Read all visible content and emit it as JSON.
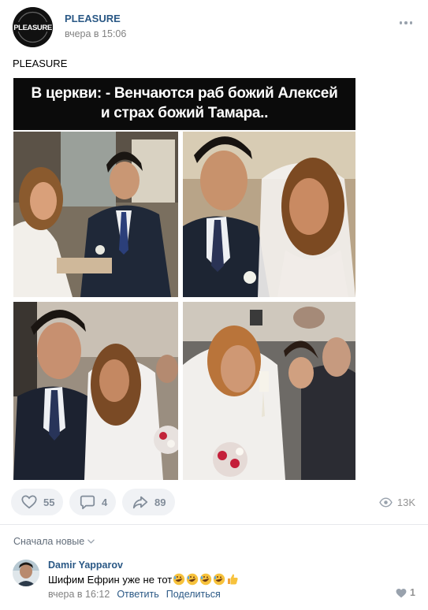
{
  "post": {
    "author": "PLEASURE",
    "avatar_text": "PLEASURE",
    "time": "вчера в 15:06",
    "text": "PLEASURE",
    "media": {
      "caption_line1": "В церкви: - Венчаются раб божий Алексей",
      "caption_line2": "и страх божий Тамара.."
    },
    "actions": {
      "likes": "55",
      "comments": "4",
      "shares": "89",
      "views": "13K"
    }
  },
  "comments_section": {
    "sort_label": "Сначала новые",
    "comments": [
      {
        "author": "Damir Yapparov",
        "text": "Шифим Ефрин уже не тот",
        "emoji": [
          "rolling-laughing",
          "rolling-laughing",
          "rolling-laughing",
          "rolling-laughing",
          "thumbs-up"
        ],
        "time": "вчера в 16:12",
        "reply_label": "Ответить",
        "share_label": "Поделиться",
        "likes": "1"
      }
    ]
  },
  "colors": {
    "link": "#2a5885",
    "muted": "#828282",
    "action_bg": "#f0f2f5",
    "icon": "#818c99"
  }
}
